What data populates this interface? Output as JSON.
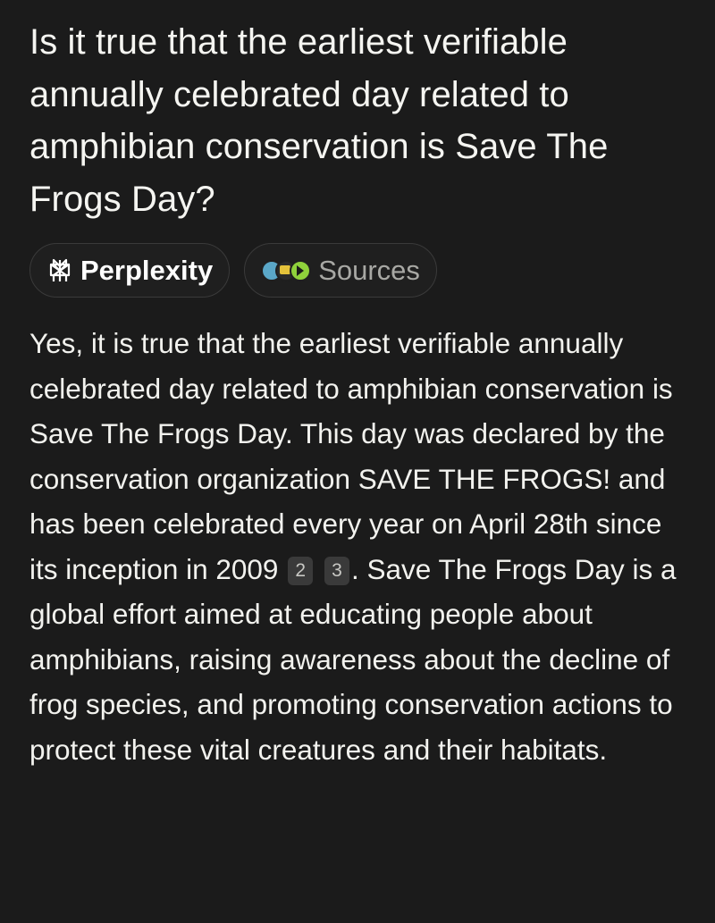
{
  "question": "Is it true that the earliest verifiable annually celebrated day related to amphibian conservation is Save The Frogs Day?",
  "chips": {
    "perplexity": {
      "label": "Perplexity",
      "icon": "perplexity-logo-icon"
    },
    "sources": {
      "label": "Sources",
      "icons": [
        "source-favicon-1",
        "source-favicon-2",
        "source-favicon-3"
      ]
    }
  },
  "answer": {
    "part1": "Yes, it is true that the earliest verifiable annually celebrated day related to amphibian conservation is Save The Frogs Day. This day was declared by the conservation organization SAVE THE FROGS! and has been celebrated every year on April 28th since its inception in 2009",
    "cite1": "2",
    "cite2": "3",
    "part2": ". Save The Frogs Day is a global effort aimed at educating people about amphibians, raising awareness about the decline of frog species, and promoting conservation actions to protect these vital creatures and their habitats."
  },
  "colors": {
    "background": "#1b1b1b",
    "text": "#f2f2ee",
    "muted": "#a8a8a4",
    "chip_border": "#3a3a3a"
  }
}
